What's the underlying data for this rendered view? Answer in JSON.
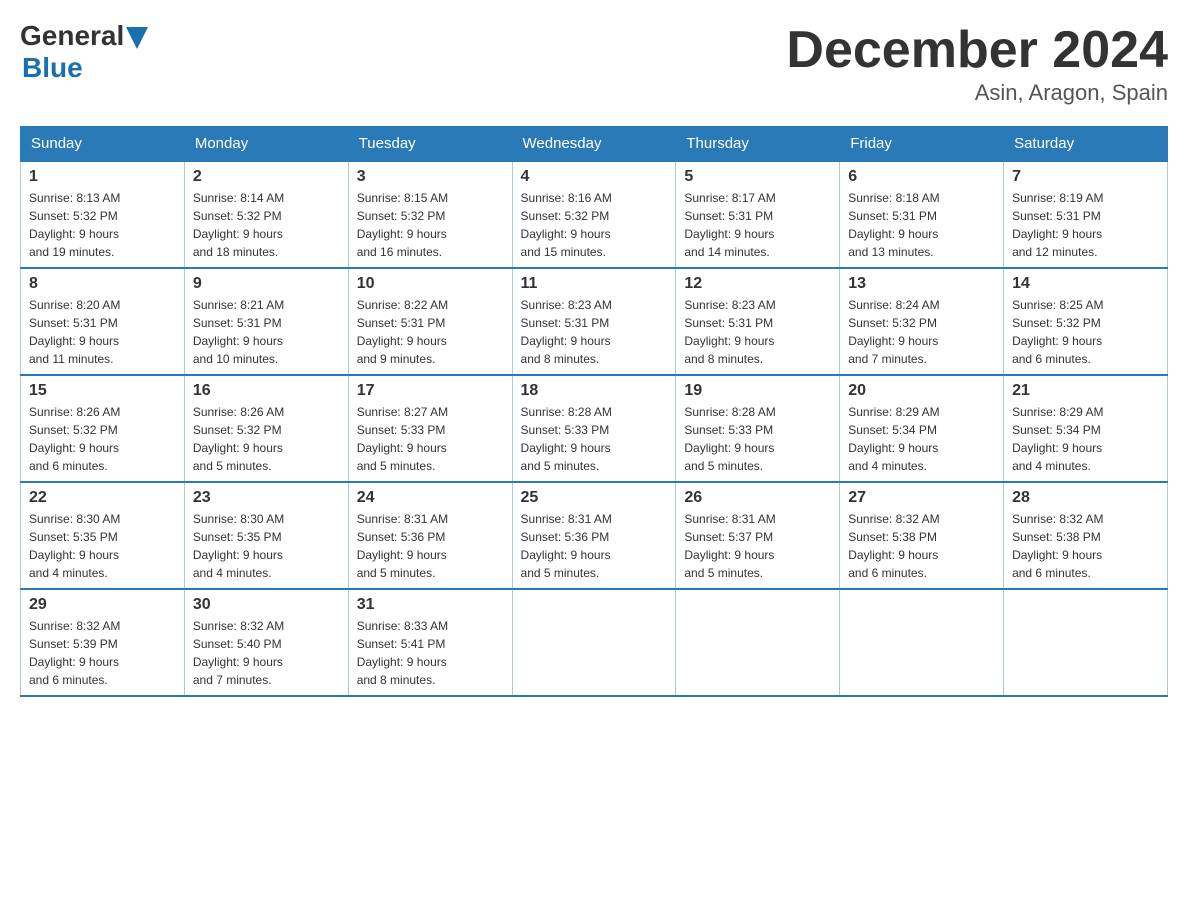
{
  "header": {
    "logo_general": "General",
    "logo_blue": "Blue",
    "month_title": "December 2024",
    "location": "Asin, Aragon, Spain"
  },
  "days_of_week": [
    "Sunday",
    "Monday",
    "Tuesday",
    "Wednesday",
    "Thursday",
    "Friday",
    "Saturday"
  ],
  "weeks": [
    [
      {
        "day": "1",
        "sunrise": "8:13 AM",
        "sunset": "5:32 PM",
        "daylight": "9 hours and 19 minutes."
      },
      {
        "day": "2",
        "sunrise": "8:14 AM",
        "sunset": "5:32 PM",
        "daylight": "9 hours and 18 minutes."
      },
      {
        "day": "3",
        "sunrise": "8:15 AM",
        "sunset": "5:32 PM",
        "daylight": "9 hours and 16 minutes."
      },
      {
        "day": "4",
        "sunrise": "8:16 AM",
        "sunset": "5:32 PM",
        "daylight": "9 hours and 15 minutes."
      },
      {
        "day": "5",
        "sunrise": "8:17 AM",
        "sunset": "5:31 PM",
        "daylight": "9 hours and 14 minutes."
      },
      {
        "day": "6",
        "sunrise": "8:18 AM",
        "sunset": "5:31 PM",
        "daylight": "9 hours and 13 minutes."
      },
      {
        "day": "7",
        "sunrise": "8:19 AM",
        "sunset": "5:31 PM",
        "daylight": "9 hours and 12 minutes."
      }
    ],
    [
      {
        "day": "8",
        "sunrise": "8:20 AM",
        "sunset": "5:31 PM",
        "daylight": "9 hours and 11 minutes."
      },
      {
        "day": "9",
        "sunrise": "8:21 AM",
        "sunset": "5:31 PM",
        "daylight": "9 hours and 10 minutes."
      },
      {
        "day": "10",
        "sunrise": "8:22 AM",
        "sunset": "5:31 PM",
        "daylight": "9 hours and 9 minutes."
      },
      {
        "day": "11",
        "sunrise": "8:23 AM",
        "sunset": "5:31 PM",
        "daylight": "9 hours and 8 minutes."
      },
      {
        "day": "12",
        "sunrise": "8:23 AM",
        "sunset": "5:31 PM",
        "daylight": "9 hours and 8 minutes."
      },
      {
        "day": "13",
        "sunrise": "8:24 AM",
        "sunset": "5:32 PM",
        "daylight": "9 hours and 7 minutes."
      },
      {
        "day": "14",
        "sunrise": "8:25 AM",
        "sunset": "5:32 PM",
        "daylight": "9 hours and 6 minutes."
      }
    ],
    [
      {
        "day": "15",
        "sunrise": "8:26 AM",
        "sunset": "5:32 PM",
        "daylight": "9 hours and 6 minutes."
      },
      {
        "day": "16",
        "sunrise": "8:26 AM",
        "sunset": "5:32 PM",
        "daylight": "9 hours and 5 minutes."
      },
      {
        "day": "17",
        "sunrise": "8:27 AM",
        "sunset": "5:33 PM",
        "daylight": "9 hours and 5 minutes."
      },
      {
        "day": "18",
        "sunrise": "8:28 AM",
        "sunset": "5:33 PM",
        "daylight": "9 hours and 5 minutes."
      },
      {
        "day": "19",
        "sunrise": "8:28 AM",
        "sunset": "5:33 PM",
        "daylight": "9 hours and 5 minutes."
      },
      {
        "day": "20",
        "sunrise": "8:29 AM",
        "sunset": "5:34 PM",
        "daylight": "9 hours and 4 minutes."
      },
      {
        "day": "21",
        "sunrise": "8:29 AM",
        "sunset": "5:34 PM",
        "daylight": "9 hours and 4 minutes."
      }
    ],
    [
      {
        "day": "22",
        "sunrise": "8:30 AM",
        "sunset": "5:35 PM",
        "daylight": "9 hours and 4 minutes."
      },
      {
        "day": "23",
        "sunrise": "8:30 AM",
        "sunset": "5:35 PM",
        "daylight": "9 hours and 4 minutes."
      },
      {
        "day": "24",
        "sunrise": "8:31 AM",
        "sunset": "5:36 PM",
        "daylight": "9 hours and 5 minutes."
      },
      {
        "day": "25",
        "sunrise": "8:31 AM",
        "sunset": "5:36 PM",
        "daylight": "9 hours and 5 minutes."
      },
      {
        "day": "26",
        "sunrise": "8:31 AM",
        "sunset": "5:37 PM",
        "daylight": "9 hours and 5 minutes."
      },
      {
        "day": "27",
        "sunrise": "8:32 AM",
        "sunset": "5:38 PM",
        "daylight": "9 hours and 6 minutes."
      },
      {
        "day": "28",
        "sunrise": "8:32 AM",
        "sunset": "5:38 PM",
        "daylight": "9 hours and 6 minutes."
      }
    ],
    [
      {
        "day": "29",
        "sunrise": "8:32 AM",
        "sunset": "5:39 PM",
        "daylight": "9 hours and 6 minutes."
      },
      {
        "day": "30",
        "sunrise": "8:32 AM",
        "sunset": "5:40 PM",
        "daylight": "9 hours and 7 minutes."
      },
      {
        "day": "31",
        "sunrise": "8:33 AM",
        "sunset": "5:41 PM",
        "daylight": "9 hours and 8 minutes."
      },
      null,
      null,
      null,
      null
    ]
  ]
}
